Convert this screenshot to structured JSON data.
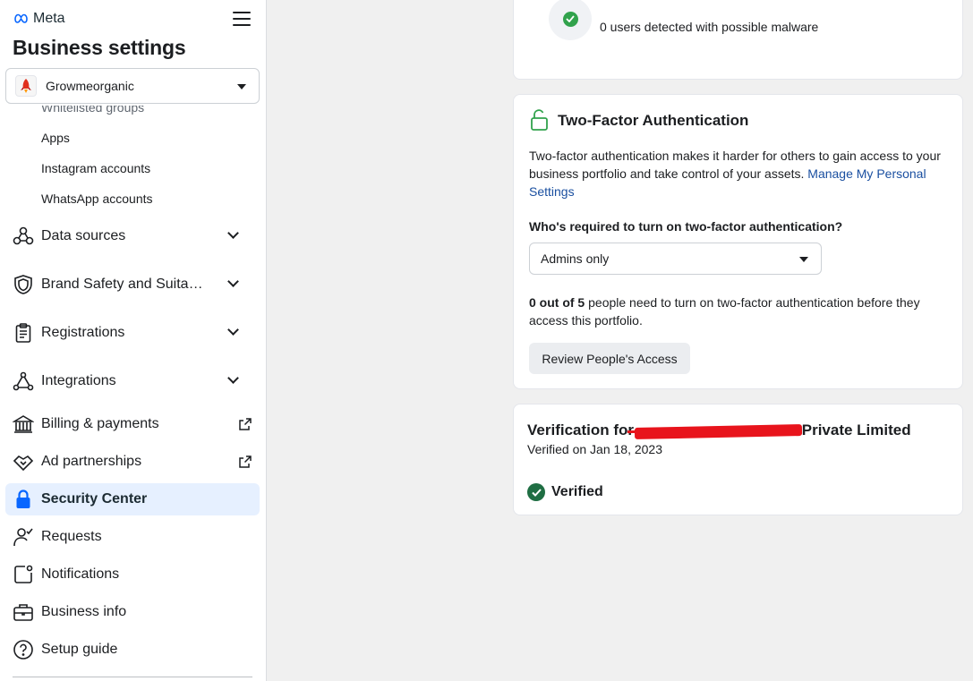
{
  "header": {
    "brand": "Meta",
    "title": "Business settings"
  },
  "account": {
    "name": "Growmeorganic"
  },
  "sidebar": {
    "partial_item": "Whitelisted groups",
    "sub_items": [
      {
        "label": "Apps"
      },
      {
        "label": "Instagram accounts"
      },
      {
        "label": "WhatsApp accounts"
      }
    ],
    "items": [
      {
        "label": "Data sources"
      },
      {
        "label": "Brand Safety and Suitability"
      },
      {
        "label": "Registrations"
      },
      {
        "label": "Integrations"
      },
      {
        "label": "Billing & payments"
      },
      {
        "label": "Ad partnerships"
      },
      {
        "label": "Security Center"
      },
      {
        "label": "Requests"
      },
      {
        "label": "Notifications"
      },
      {
        "label": "Business info"
      },
      {
        "label": "Setup guide"
      }
    ]
  },
  "malware": {
    "text": "0 users detected with possible malware"
  },
  "two_factor": {
    "title": "Two-Factor Authentication",
    "description": "Two-factor authentication makes it harder for others to gain access to your business portfolio and take control of your assets. ",
    "manage_link": "Manage My Personal Settings",
    "question": "Who's required to turn on two-factor authentication?",
    "selected_option": "Admins only",
    "count_bold": "0 out of 5",
    "count_rest": " people need to turn on two-factor authentication before they access this portfolio.",
    "review_button": "Review People's Access"
  },
  "verification": {
    "title_prefix": "Verification for ",
    "title_suffix": "Private Limited",
    "date": "Verified on Jan 18, 2023",
    "status": "Verified"
  },
  "colors": {
    "accent": "#1a4fa0",
    "active_bg": "#e6f0ff",
    "success": "#31a24c",
    "verified": "#1f6e43",
    "redaction": "#e8141c"
  }
}
